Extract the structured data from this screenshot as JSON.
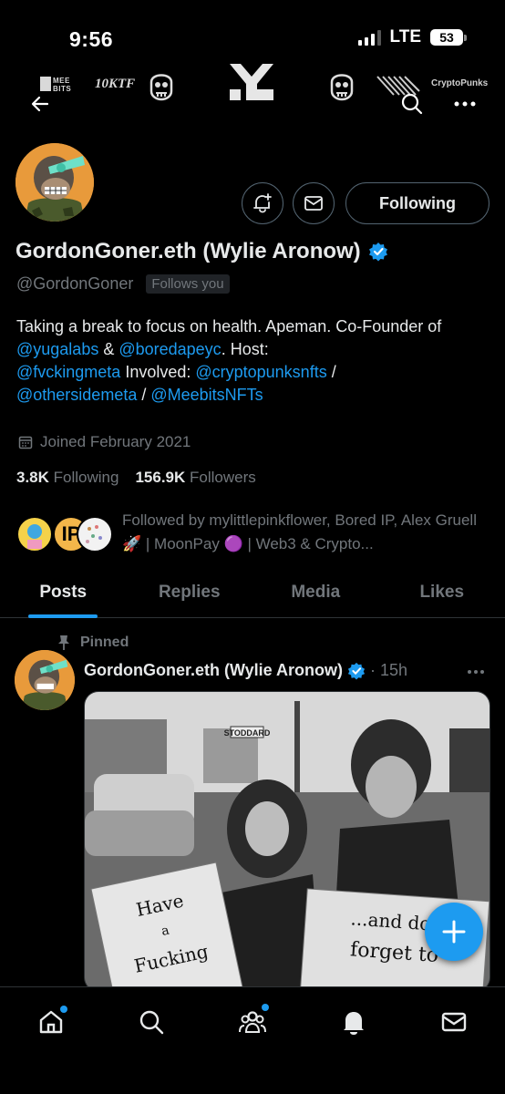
{
  "status_bar": {
    "time": "9:56",
    "network": "LTE",
    "battery": "53"
  },
  "banner": {
    "meebits_label": "MEE BITS",
    "tenktf_label": "10KTF",
    "cryptopunks_label": "CryptoPunks"
  },
  "profile": {
    "display_name": "GordonGoner.eth (Wylie Aronow)",
    "handle": "@GordonGoner",
    "follows_you": "Follows you",
    "follow_button": "Following",
    "bio": {
      "t1": "Taking a break to focus on health. Apeman. Co-Founder of ",
      "m1": "@yugalabs",
      "t2": " & ",
      "m2": "@boredapeyc",
      "t3": ". Host: ",
      "m3": "@fvckingmeta",
      "t4": " Involved: ",
      "m4": "@cryptopunksnfts",
      "t5": " / ",
      "m5": "@othersidemeta",
      "t6": " / ",
      "m6": "@MeebitsNFTs"
    },
    "joined": "Joined February 2021",
    "following_count": "3.8K",
    "following_label": "Following",
    "followers_count": "156.9K",
    "followers_label": "Followers",
    "followed_by": "Followed by mylittlepinkflower, Bored IP, Alex Gruell 🚀 | MoonPay 🟣 | Web3 & Crypto..."
  },
  "tabs": [
    "Posts",
    "Replies",
    "Media",
    "Likes"
  ],
  "post": {
    "pinned_label": "Pinned",
    "author": "GordonGoner.eth (Wylie Aronow)",
    "time": "15h",
    "sign_left": "Have a Fucking",
    "sign_right": "...and don't forget to",
    "street_sign": "STODDARD"
  },
  "colors": {
    "accent": "#1d9bf0",
    "avatar_bg": "#e89a3b",
    "background": "#000000"
  }
}
